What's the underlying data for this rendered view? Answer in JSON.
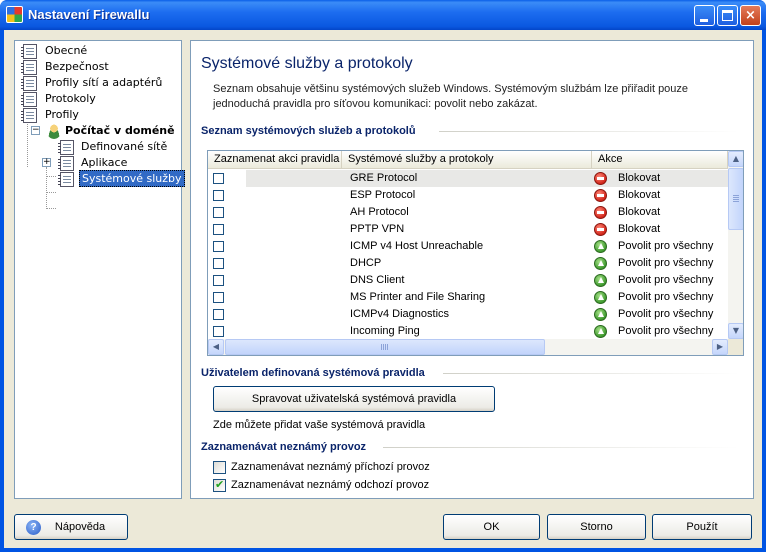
{
  "window": {
    "title": "Nastavení Firewallu",
    "controls": {
      "minimize": "minimize",
      "maximize": "maximize",
      "close": "×"
    }
  },
  "tree": {
    "items": [
      {
        "label": "Obecné",
        "icon": "document-icon"
      },
      {
        "label": "Bezpečnost",
        "icon": "document-icon"
      },
      {
        "label": "Profily sítí a adaptérů",
        "icon": "document-icon"
      },
      {
        "label": "Protokoly",
        "icon": "document-icon"
      },
      {
        "label": "Profily",
        "icon": "document-icon"
      },
      {
        "label": "Počítač v doméně",
        "icon": "user-icon",
        "expander": "−"
      },
      {
        "label": "Definované sítě",
        "icon": "user-document-icon"
      },
      {
        "label": "Aplikace",
        "icon": "document-icon",
        "expander": "+"
      },
      {
        "label": "Systémové služby",
        "icon": "document-icon",
        "selected": true
      }
    ]
  },
  "main": {
    "title": "Systémové služby a protokoly",
    "description": "Seznam obsahuje většinu systémových služeb Windows. Systémovým službám lze přiřadit pouze jednoduchá pravidla pro síťovou komunikaci: povolit nebo zakázat.",
    "list_section": {
      "heading": "Seznam systémových služeb a protokolů",
      "columns": [
        "Zaznamenat akci pravidla",
        "Systémové služby a protokoly",
        "Akce"
      ],
      "rows": [
        {
          "service": "GRE Protocol",
          "action": "Blokovat",
          "icon": "block",
          "checked": false
        },
        {
          "service": "ESP Protocol",
          "action": "Blokovat",
          "icon": "block",
          "checked": false
        },
        {
          "service": "AH Protocol",
          "action": "Blokovat",
          "icon": "block",
          "checked": false
        },
        {
          "service": "PPTP VPN",
          "action": "Blokovat",
          "icon": "block",
          "checked": false
        },
        {
          "service": "ICMP v4 Host Unreachable",
          "action": "Povolit pro všechny",
          "icon": "allow",
          "checked": false
        },
        {
          "service": "DHCP",
          "action": "Povolit pro všechny",
          "icon": "allow",
          "checked": false
        },
        {
          "service": "DNS Client",
          "action": "Povolit pro všechny",
          "icon": "allow",
          "checked": false
        },
        {
          "service": "MS Printer and File Sharing",
          "action": "Povolit pro všechny",
          "icon": "allow",
          "checked": false
        },
        {
          "service": "ICMPv4 Diagnostics",
          "action": "Povolit pro všechny",
          "icon": "allow",
          "checked": false
        },
        {
          "service": "Incoming Ping",
          "action": "Povolit pro všechny",
          "icon": "allow",
          "checked": false
        }
      ]
    },
    "user_rules": {
      "heading": "Uživatelem definovaná systémová pravidla",
      "button": "Spravovat uživatelská systémová pravidla",
      "hint": "Zde můžete přidat vaše systémová pravidla"
    },
    "unknown_traffic": {
      "heading": "Zaznamenávat neznámý provoz",
      "options": [
        {
          "label": "Zaznamenávat neznámý příchozí provoz",
          "checked": false
        },
        {
          "label": "Zaznamenávat neznámý odchozí provoz",
          "checked": true
        }
      ]
    }
  },
  "footer": {
    "help": "Nápověda",
    "ok": "OK",
    "cancel": "Storno",
    "apply": "Použít"
  }
}
